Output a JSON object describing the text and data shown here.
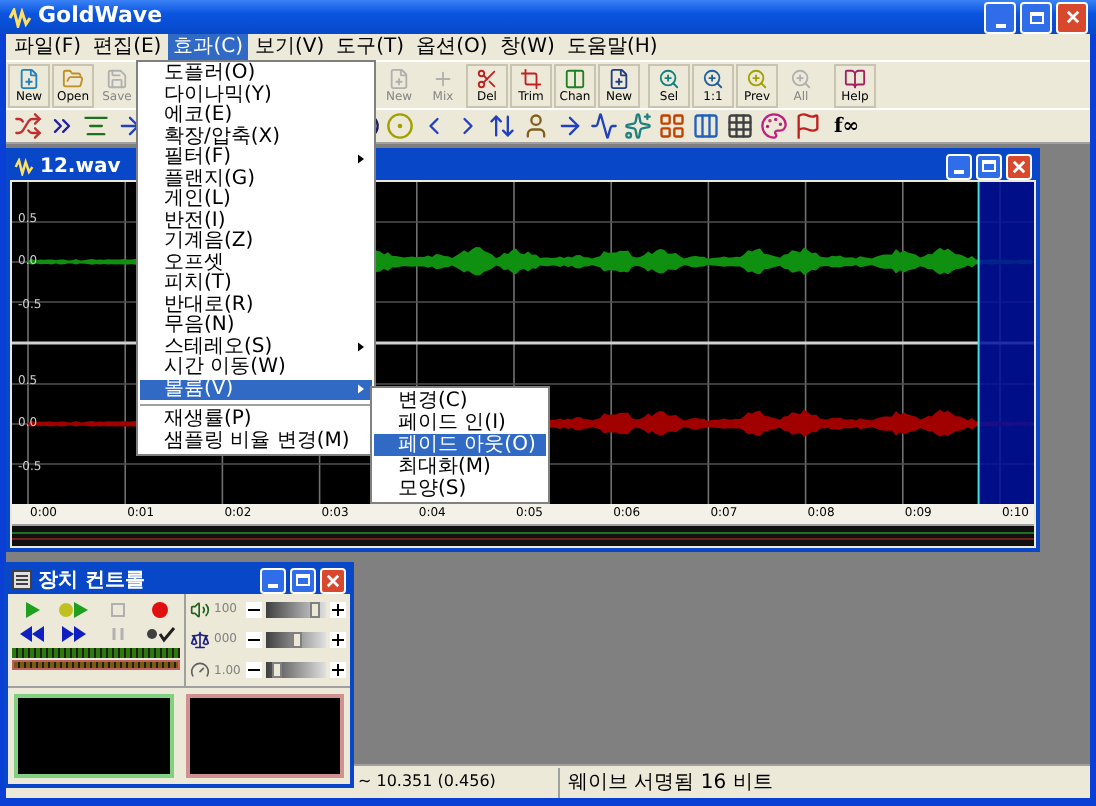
{
  "window": {
    "title": "GoldWave"
  },
  "menu_bar": [
    {
      "label": "파일(F)",
      "selected": false
    },
    {
      "label": "편집(E)",
      "selected": false
    },
    {
      "label": "효과(C)",
      "selected": true
    },
    {
      "label": "보기(V)",
      "selected": false
    },
    {
      "label": "도구(T)",
      "selected": false
    },
    {
      "label": "옵션(O)",
      "selected": false
    },
    {
      "label": "창(W)",
      "selected": false
    },
    {
      "label": "도움말(H)",
      "selected": false
    }
  ],
  "toolbar": {
    "groups": [
      [
        {
          "label": "New",
          "disabled": false
        },
        {
          "label": "Open",
          "disabled": false
        },
        {
          "label": "Save",
          "disabled": true
        }
      ],
      [
        {
          "label": "New",
          "disabled": true
        },
        {
          "label": "Mix",
          "disabled": true
        },
        {
          "label": "Del",
          "disabled": false
        },
        {
          "label": "Trim",
          "disabled": false
        },
        {
          "label": "Chan",
          "disabled": false
        },
        {
          "label": "New",
          "disabled": false
        }
      ],
      [
        {
          "label": "Sel",
          "disabled": false
        },
        {
          "label": "1:1",
          "disabled": false
        },
        {
          "label": "Prev",
          "disabled": false
        },
        {
          "label": "All",
          "disabled": true
        }
      ],
      [
        {
          "label": "Help",
          "disabled": false
        }
      ]
    ]
  },
  "toolbar_2": {
    "text_button": "f∞"
  },
  "sound_window": {
    "title": "12.wav",
    "channels": [
      {
        "color": "#109010",
        "axis_labels": [
          "0.5",
          "0.0",
          "-0.5"
        ]
      },
      {
        "color": "#a00000",
        "axis_labels": [
          "0.5",
          "0.0",
          "-0.5"
        ]
      }
    ],
    "time_labels": [
      "0:00",
      "0:01",
      "0:02",
      "0:03",
      "0:04",
      "0:05",
      "0:06",
      "0:07",
      "0:08",
      "0:09",
      "0:10"
    ]
  },
  "effects_menu": {
    "items": [
      {
        "kind": "item",
        "label": "도플러(O)",
        "submenu": false,
        "selected": false
      },
      {
        "kind": "item",
        "label": "다이나믹(Y)",
        "submenu": false,
        "selected": false
      },
      {
        "kind": "item",
        "label": "에코(E)",
        "submenu": false,
        "selected": false
      },
      {
        "kind": "item",
        "label": "확장/압축(X)",
        "submenu": false,
        "selected": false
      },
      {
        "kind": "item",
        "label": "필터(F)",
        "submenu": true,
        "selected": false
      },
      {
        "kind": "item",
        "label": "플랜지(G)",
        "submenu": false,
        "selected": false
      },
      {
        "kind": "item",
        "label": "게인(L)",
        "submenu": false,
        "selected": false
      },
      {
        "kind": "item",
        "label": "반전(I)",
        "submenu": false,
        "selected": false
      },
      {
        "kind": "item",
        "label": "기계음(Z)",
        "submenu": false,
        "selected": false
      },
      {
        "kind": "item",
        "label": "오프셋",
        "submenu": false,
        "selected": false
      },
      {
        "kind": "item",
        "label": "피치(T)",
        "submenu": false,
        "selected": false
      },
      {
        "kind": "item",
        "label": "반대로(R)",
        "submenu": false,
        "selected": false
      },
      {
        "kind": "item",
        "label": "무음(N)",
        "submenu": false,
        "selected": false
      },
      {
        "kind": "item",
        "label": "스테레오(S)",
        "submenu": true,
        "selected": false
      },
      {
        "kind": "item",
        "label": "시간 이동(W)",
        "submenu": false,
        "selected": false
      },
      {
        "kind": "item",
        "label": "볼륨(V)",
        "submenu": true,
        "selected": true
      },
      {
        "kind": "separator"
      },
      {
        "kind": "item",
        "label": "재생률(P)",
        "submenu": false,
        "selected": false
      },
      {
        "kind": "item",
        "label": "샘플링 비율 변경(M)",
        "submenu": false,
        "selected": false
      }
    ]
  },
  "volume_submenu": {
    "items": [
      {
        "label": "변경(C)",
        "selected": false
      },
      {
        "label": "페이드 인(I)",
        "selected": false
      },
      {
        "label": "페이드 아웃(O)",
        "selected": true
      },
      {
        "label": "최대화(M)",
        "selected": false
      },
      {
        "label": "모양(S)",
        "selected": false
      }
    ]
  },
  "control_window": {
    "title": "장치 컨트롤",
    "transport": [
      {
        "kind": "play",
        "disabled": false
      },
      {
        "kind": "play_selection",
        "disabled": false
      },
      {
        "kind": "stop",
        "disabled": true
      },
      {
        "kind": "record",
        "disabled": false
      },
      {
        "kind": "rewind",
        "disabled": false
      },
      {
        "kind": "forward",
        "disabled": false
      },
      {
        "kind": "pause",
        "disabled": true
      },
      {
        "kind": "record_mode",
        "disabled": false
      }
    ],
    "sliders": [
      {
        "kind": "volume",
        "reading": "100",
        "level": 0.88
      },
      {
        "kind": "balance",
        "reading": "000",
        "level": 0.5
      },
      {
        "kind": "speed",
        "reading": "1.00",
        "level": 0.12
      }
    ]
  },
  "status_bar": {
    "position": "~ 10.351 (0.456)",
    "format": "웨이브 서명됨 16 비트"
  }
}
